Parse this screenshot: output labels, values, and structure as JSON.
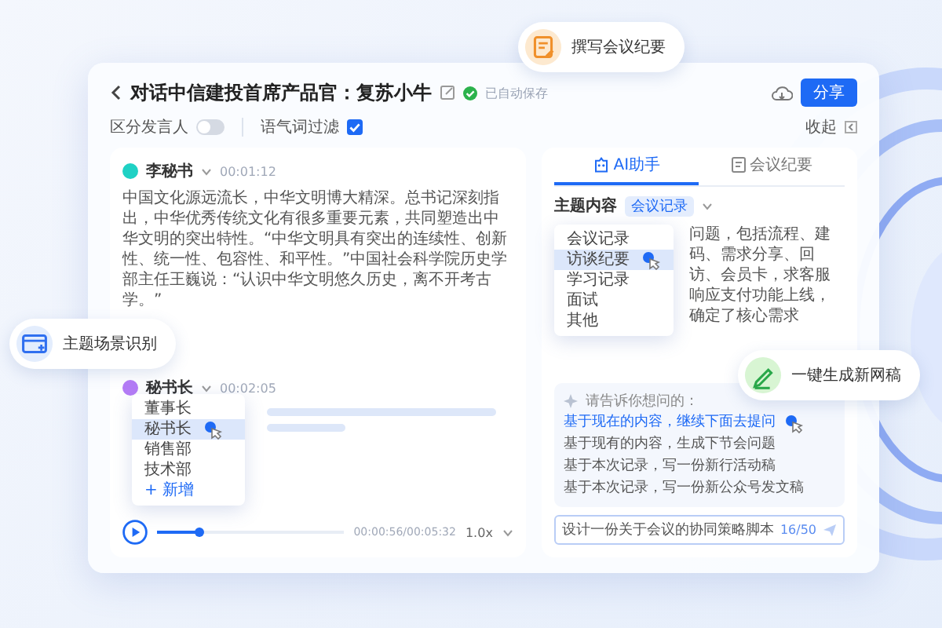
{
  "header": {
    "title": "对话中信建投首席产品官：复苏小牛",
    "status": "已自动保存",
    "share_button": "分享"
  },
  "toolbar": {
    "speaker_toggle": {
      "label": "区分发言人",
      "on": false
    },
    "filler_filter": {
      "label": "语气词过滤",
      "checked": true
    },
    "collapse": "收起"
  },
  "transcript": {
    "segments": [
      {
        "speaker": "李秘书",
        "time": "00:01:12",
        "color": "#1fd1c4",
        "text": "中国文化源远流长，中华文明博大精深。总书记深刻指出，中华优秀传统文化有很多重要元素，共同塑造出中华文明的突出特性。“中华文明具有突出的连续性、创新性、统一性、包容性、和平性。”中国社会科学院历史学部主任王巍说：“认识中华文明悠久历史，离不开考古学。”"
      },
      {
        "speaker": "秘书长",
        "time": "00:02:05",
        "color": "#b57cf6"
      }
    ],
    "speaker_menu": {
      "items": [
        {
          "label": "董事长",
          "selected": false
        },
        {
          "label": "秘书长",
          "selected": true
        },
        {
          "label": "销售部",
          "selected": false
        },
        {
          "label": "技术部",
          "selected": false
        }
      ],
      "add": "+ 新增"
    }
  },
  "player": {
    "level": 0.23,
    "time": "00:00:56/00:05:32",
    "speed": "1.0x"
  },
  "assistant": {
    "tabs": [
      {
        "label": "AI助手",
        "selected": true
      },
      {
        "label": "会议纪要",
        "selected": false
      }
    ],
    "topic_label": "主题内容",
    "topic_chip": "会议记录",
    "topic_menu": [
      {
        "label": "会议记录",
        "selected": false
      },
      {
        "label": "访谈纪要",
        "selected": true
      },
      {
        "label": "学习记录",
        "selected": false
      },
      {
        "label": "面试",
        "selected": false
      },
      {
        "label": "其他",
        "selected": false
      }
    ],
    "summary": "问题，包括流程、建码、需求分享、回访、会员卡，求客服响应支付功能上线，确定了核心需求",
    "prompt_title": "请告诉你想问的：",
    "suggestions": [
      {
        "text": "基于现在的内容，继续下面去提问",
        "selected": true
      },
      {
        "text": "基于现有的内容，生成下节会问题",
        "selected": false
      },
      {
        "text": "基于本次记录，写一份新行活动稿",
        "selected": false
      },
      {
        "text": "基于本次记录，写一份新公众号发文稿",
        "selected": false
      }
    ],
    "input": {
      "value": "设计一份关于会议的协同策略脚本",
      "counter": "16/50"
    }
  },
  "callouts": [
    {
      "kind": "document",
      "text": "撰写会议纪要"
    },
    {
      "kind": "window",
      "text": "主题场景识别"
    },
    {
      "kind": "pen",
      "text": "一键生成新网稿"
    }
  ]
}
